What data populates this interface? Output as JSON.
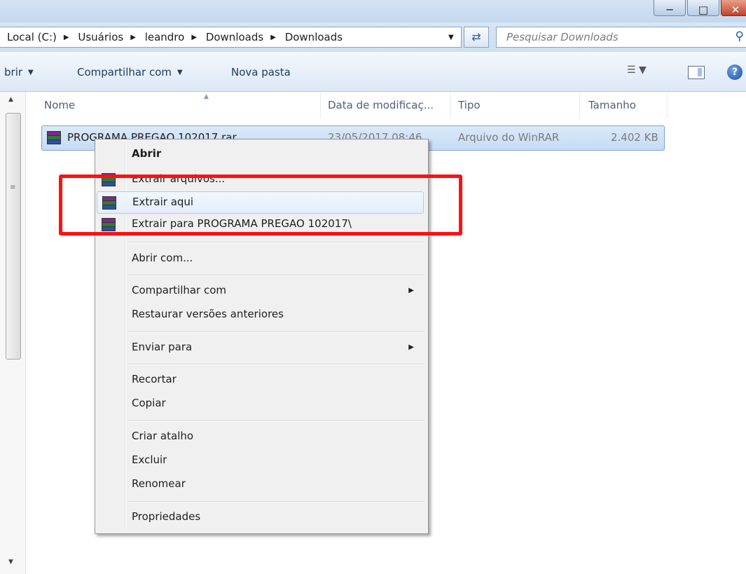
{
  "breadcrumb": [
    "Local (C:)",
    "Usuários",
    "leandro",
    "Downloads",
    "Downloads"
  ],
  "search": {
    "placeholder": "Pesquisar Downloads"
  },
  "toolbar": {
    "open_label": "brir",
    "share_label": "Compartilhar com",
    "new_folder_label": "Nova pasta"
  },
  "columns": {
    "name": "Nome",
    "date": "Data de modificaç...",
    "type": "Tipo",
    "size": "Tamanho"
  },
  "file": {
    "name": "PROGRAMA PREGAO 102017.rar",
    "date": "23/05/2017 08:46",
    "type": "Arquivo do WinRAR",
    "size": "2.402 KB"
  },
  "context_menu": {
    "open": "Abrir",
    "extract_files": "Extrair arquivos...",
    "extract_here": "Extrair aqui",
    "extract_to": "Extrair para PROGRAMA PREGAO 102017\\",
    "open_with": "Abrir com...",
    "share_with": "Compartilhar com",
    "restore_versions": "Restaurar versões anteriores",
    "send_to": "Enviar para",
    "cut": "Recortar",
    "copy": "Copiar",
    "create_shortcut": "Criar atalho",
    "delete": "Excluir",
    "rename": "Renomear",
    "properties": "Propriedades"
  },
  "colors": {
    "highlight_box": "#ff1010",
    "selection": "#cce0f7"
  },
  "icons": [
    "winrar-icon",
    "search-icon",
    "refresh-icon",
    "help-icon",
    "view-options-icon",
    "preview-pane-icon"
  ]
}
